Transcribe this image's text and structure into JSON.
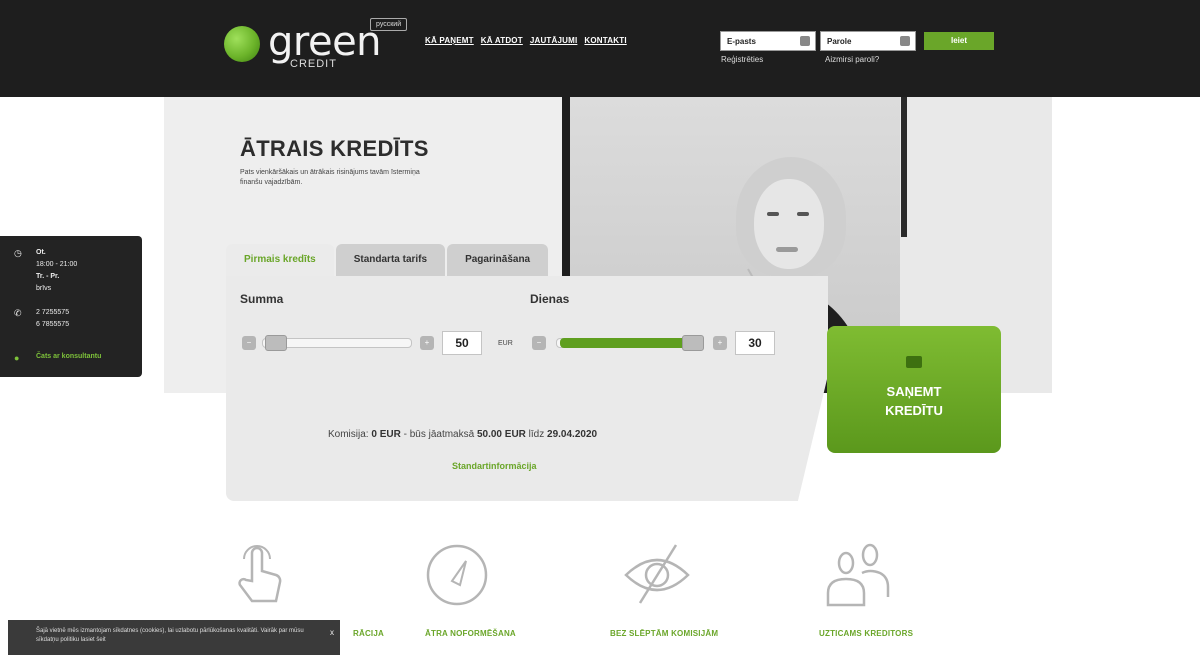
{
  "header": {
    "logo_text": "green",
    "logo_sub": "CREDIT",
    "language": "русский",
    "nav": [
      "KĀ PAŅEMT",
      "KĀ ATDOT",
      "JAUTĀJUMI",
      "KONTAKTI"
    ],
    "email_placeholder": "E-pasts",
    "password_placeholder": "Parole",
    "login_button": "Ieiet",
    "register_link": "Reģistrēties",
    "forgot_link": "Aizmirsi paroli?"
  },
  "hero": {
    "title": "ĀTRAIS KREDĪTS",
    "description": "Pats vienkāršākais un ātrākais risinājums tavām īstermiņa finanšu vajadzībām."
  },
  "calculator": {
    "tabs": [
      "Pirmais kredīts",
      "Standarta tarifs",
      "Pagarināšana"
    ],
    "active_tab": 0,
    "amount_label": "Summa",
    "amount_value": "50",
    "amount_unit": "EUR",
    "amount_fraction": 0.02,
    "days_label": "Dienas",
    "days_value": "30",
    "days_fraction": 1.0,
    "summary_prefix": "Komisija: ",
    "summary_fee": "0 EUR",
    "summary_mid": " - būs jāatmaksā ",
    "summary_total": "50.00 EUR",
    "summary_until": " līdz ",
    "summary_date": "29.04.2020",
    "standard_info_link": "Standartinformācija",
    "cta_line1": "SAŅEMT",
    "cta_line2": "KREDĪTU"
  },
  "side_info": {
    "day_label": "Ot.",
    "day_hours": "18:00 - 21:00",
    "days_range": "Tr. - Pr.",
    "days_status": "brīvs",
    "phone1": "2 7255575",
    "phone2": "6 7855575",
    "chat": "Čats ar konsultantu"
  },
  "features": [
    {
      "label": "RĀCIJA",
      "icon": "touch-icon"
    },
    {
      "label": "ĀTRA NOFORMĒŠANA",
      "icon": "speedometer-icon"
    },
    {
      "label": "BEZ SLĒPTĀM KOMISIJĀM",
      "icon": "eye-crossed-icon"
    },
    {
      "label": "UZTICAMS KREDITORS",
      "icon": "users-icon"
    }
  ],
  "cookie": {
    "text": "Šajā vietnē mēs izmantojam sīkdatnes (cookies), lai uzlabotu pārlūkošanas kvalitāti. Vairāk par mūsu sīkdatņu politiku lasiet šeit",
    "close": "x"
  },
  "colors": {
    "brand_green": "#6aa629",
    "header_bg": "#1e1e1e",
    "panel_bg": "#eaeaea"
  }
}
